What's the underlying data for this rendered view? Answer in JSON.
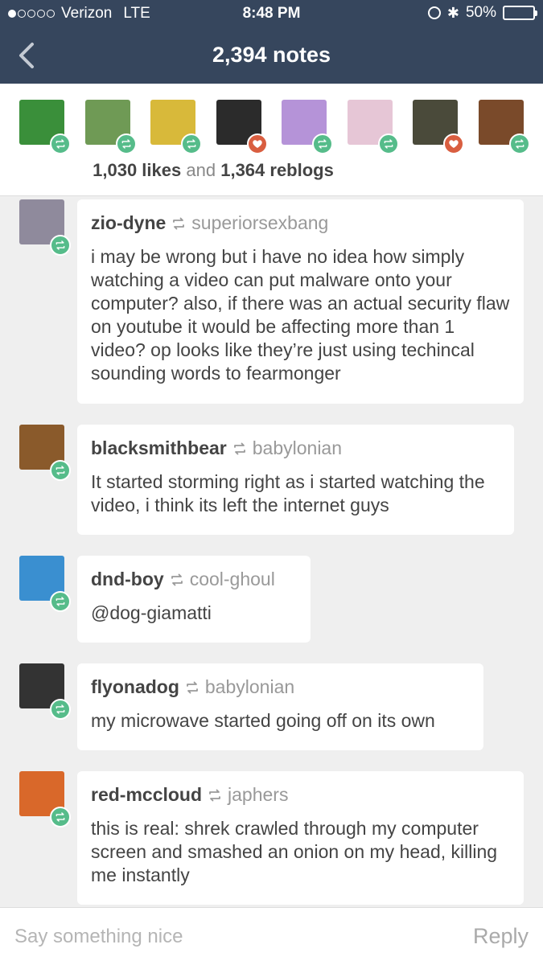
{
  "status_bar": {
    "carrier": "Verizon",
    "network": "LTE",
    "time": "8:48 PM",
    "battery": "50%",
    "battery_level": 0.5
  },
  "nav": {
    "title": "2,394 notes",
    "back_icon": "chevron-left-icon"
  },
  "summary": {
    "likes": "1,030 likes",
    "and": "and",
    "reblogs": "1,364 reblogs",
    "avatars": [
      {
        "type": "reblog",
        "color": "#3a8f3a"
      },
      {
        "type": "reblog",
        "color": "#6f9a55"
      },
      {
        "type": "reblog",
        "color": "#d8b93a"
      },
      {
        "type": "like",
        "color": "#2b2b2b"
      },
      {
        "type": "reblog",
        "color": "#b593d8"
      },
      {
        "type": "reblog",
        "color": "#e6c6d6"
      },
      {
        "type": "like",
        "color": "#4a4a3a"
      },
      {
        "type": "reblog",
        "color": "#7a4a2a"
      }
    ]
  },
  "notes": [
    {
      "user": "zio-dyne",
      "source": "superiorsexbang",
      "text": "i may be wrong but i have no idea how simply watching a video can put malware onto your computer? also, if there was an actual security flaw on youtube it would be affecting more than 1 video? op looks like they’re just using techincal sounding words to fearmonger",
      "avatar_color": "#8f8a9c"
    },
    {
      "user": "blacksmithbear",
      "source": "babylonian",
      "text": "It started storming right as i started watching the video, i think its left the internet guys",
      "avatar_color": "#8a5a2b"
    },
    {
      "user": "dnd-boy",
      "source": "cool-ghoul",
      "text": "@dog-giamatti",
      "avatar_color": "#3a8fd0"
    },
    {
      "user": "flyonadog",
      "source": "babylonian",
      "text": "my microwave started going off on its own",
      "avatar_color": "#333333"
    },
    {
      "user": "red-mccloud",
      "source": "japhers",
      "text": "this is real: shrek crawled through my computer screen and smashed an onion on my head, killing me instantly",
      "avatar_color": "#d9682a"
    }
  ],
  "reply_bar": {
    "placeholder": "Say something nice",
    "reply_label": "Reply"
  },
  "colors": {
    "nav_bg": "#36465d",
    "reblog_badge": "#56bc8a",
    "like_badge": "#d95e40",
    "page_bg": "#efefef"
  }
}
